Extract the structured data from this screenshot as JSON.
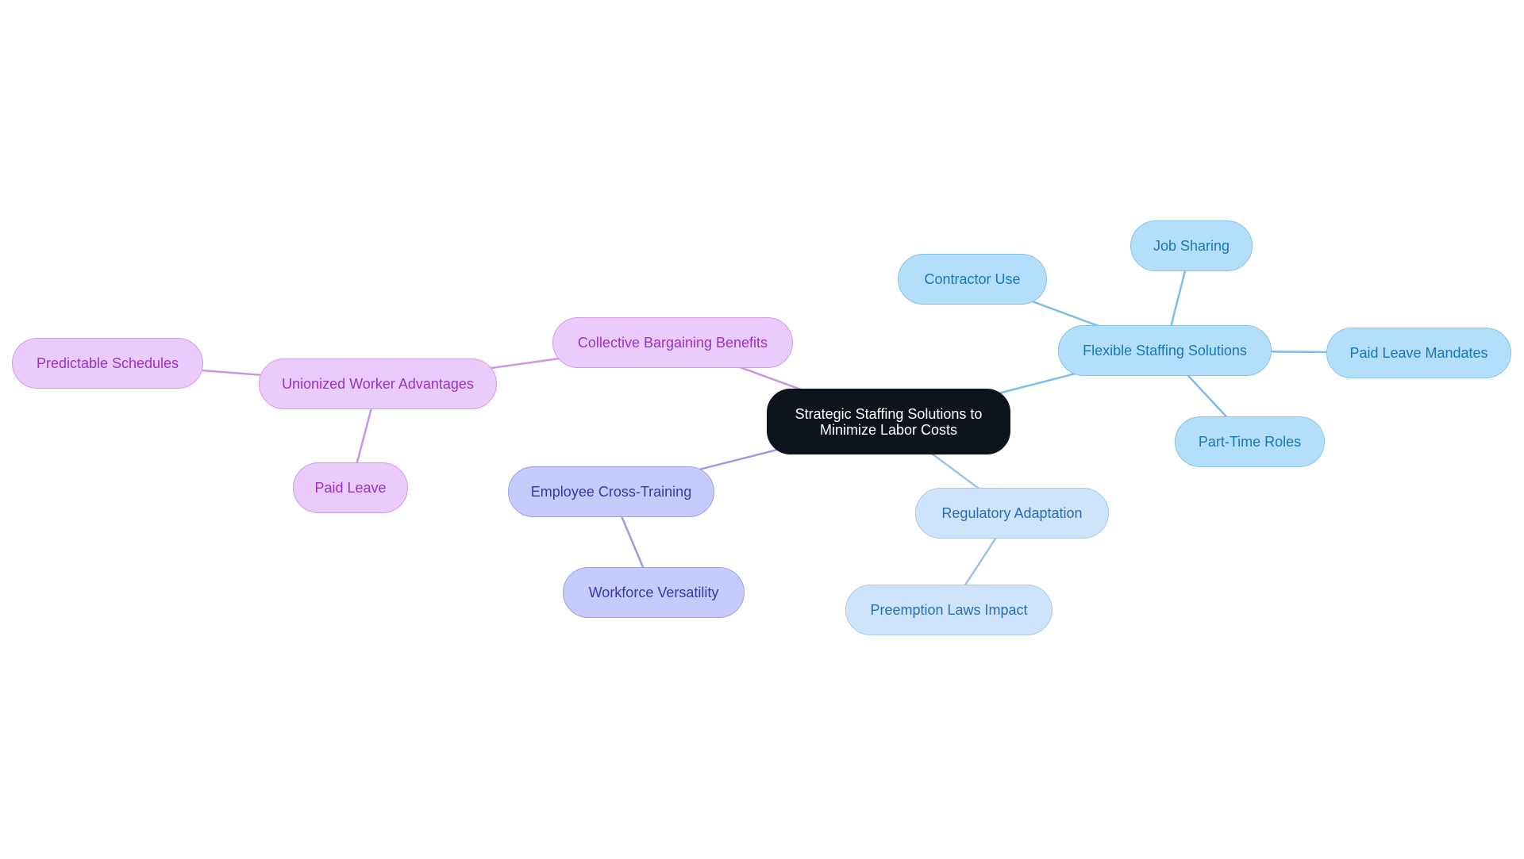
{
  "diagram": {
    "type": "mind-map",
    "root": {
      "id": "root",
      "label": "Strategic Staffing Solutions to\nMinimize Labor Costs",
      "theme": "root"
    },
    "nodes": [
      {
        "id": "flexible",
        "label": "Flexible Staffing Solutions",
        "parent": "root",
        "theme": "sky"
      },
      {
        "id": "contractor",
        "label": "Contractor Use",
        "parent": "flexible",
        "theme": "sky"
      },
      {
        "id": "jobsharing",
        "label": "Job Sharing",
        "parent": "flexible",
        "theme": "sky"
      },
      {
        "id": "paidleavemandates",
        "label": "Paid Leave Mandates",
        "parent": "flexible",
        "theme": "sky"
      },
      {
        "id": "parttime",
        "label": "Part-Time Roles",
        "parent": "flexible",
        "theme": "sky"
      },
      {
        "id": "regulatory",
        "label": "Regulatory Adaptation",
        "parent": "root",
        "theme": "pale"
      },
      {
        "id": "preemption",
        "label": "Preemption Laws Impact",
        "parent": "regulatory",
        "theme": "pale"
      },
      {
        "id": "collective",
        "label": "Collective Bargaining Benefits",
        "parent": "root",
        "theme": "lilac"
      },
      {
        "id": "unionized",
        "label": "Unionized Worker Advantages",
        "parent": "collective",
        "theme": "lilac"
      },
      {
        "id": "predictable",
        "label": "Predictable Schedules",
        "parent": "unionized",
        "theme": "lilac"
      },
      {
        "id": "paidleave",
        "label": "Paid Leave",
        "parent": "unionized",
        "theme": "lilac"
      },
      {
        "id": "crosstraining",
        "label": "Employee Cross-Training",
        "parent": "root",
        "theme": "peri"
      },
      {
        "id": "versatility",
        "label": "Workforce Versatility",
        "parent": "crosstraining",
        "theme": "peri"
      }
    ],
    "colors": {
      "root_fill": "#0d141b",
      "sky_fill": "#b3dffa",
      "sky_text": "#1a76b8",
      "sky_edge": "#7dbde6",
      "pale_fill": "#cde4fb",
      "pale_text": "#2a6db6",
      "pale_edge": "#9cc2ea",
      "lilac_fill": "#eacbfc",
      "lilac_text": "#9633c4",
      "lilac_edge": "#cc94e6",
      "peri_fill": "#c7cafc",
      "peri_text": "#3c36a6",
      "peri_edge": "#9a9be2"
    }
  }
}
